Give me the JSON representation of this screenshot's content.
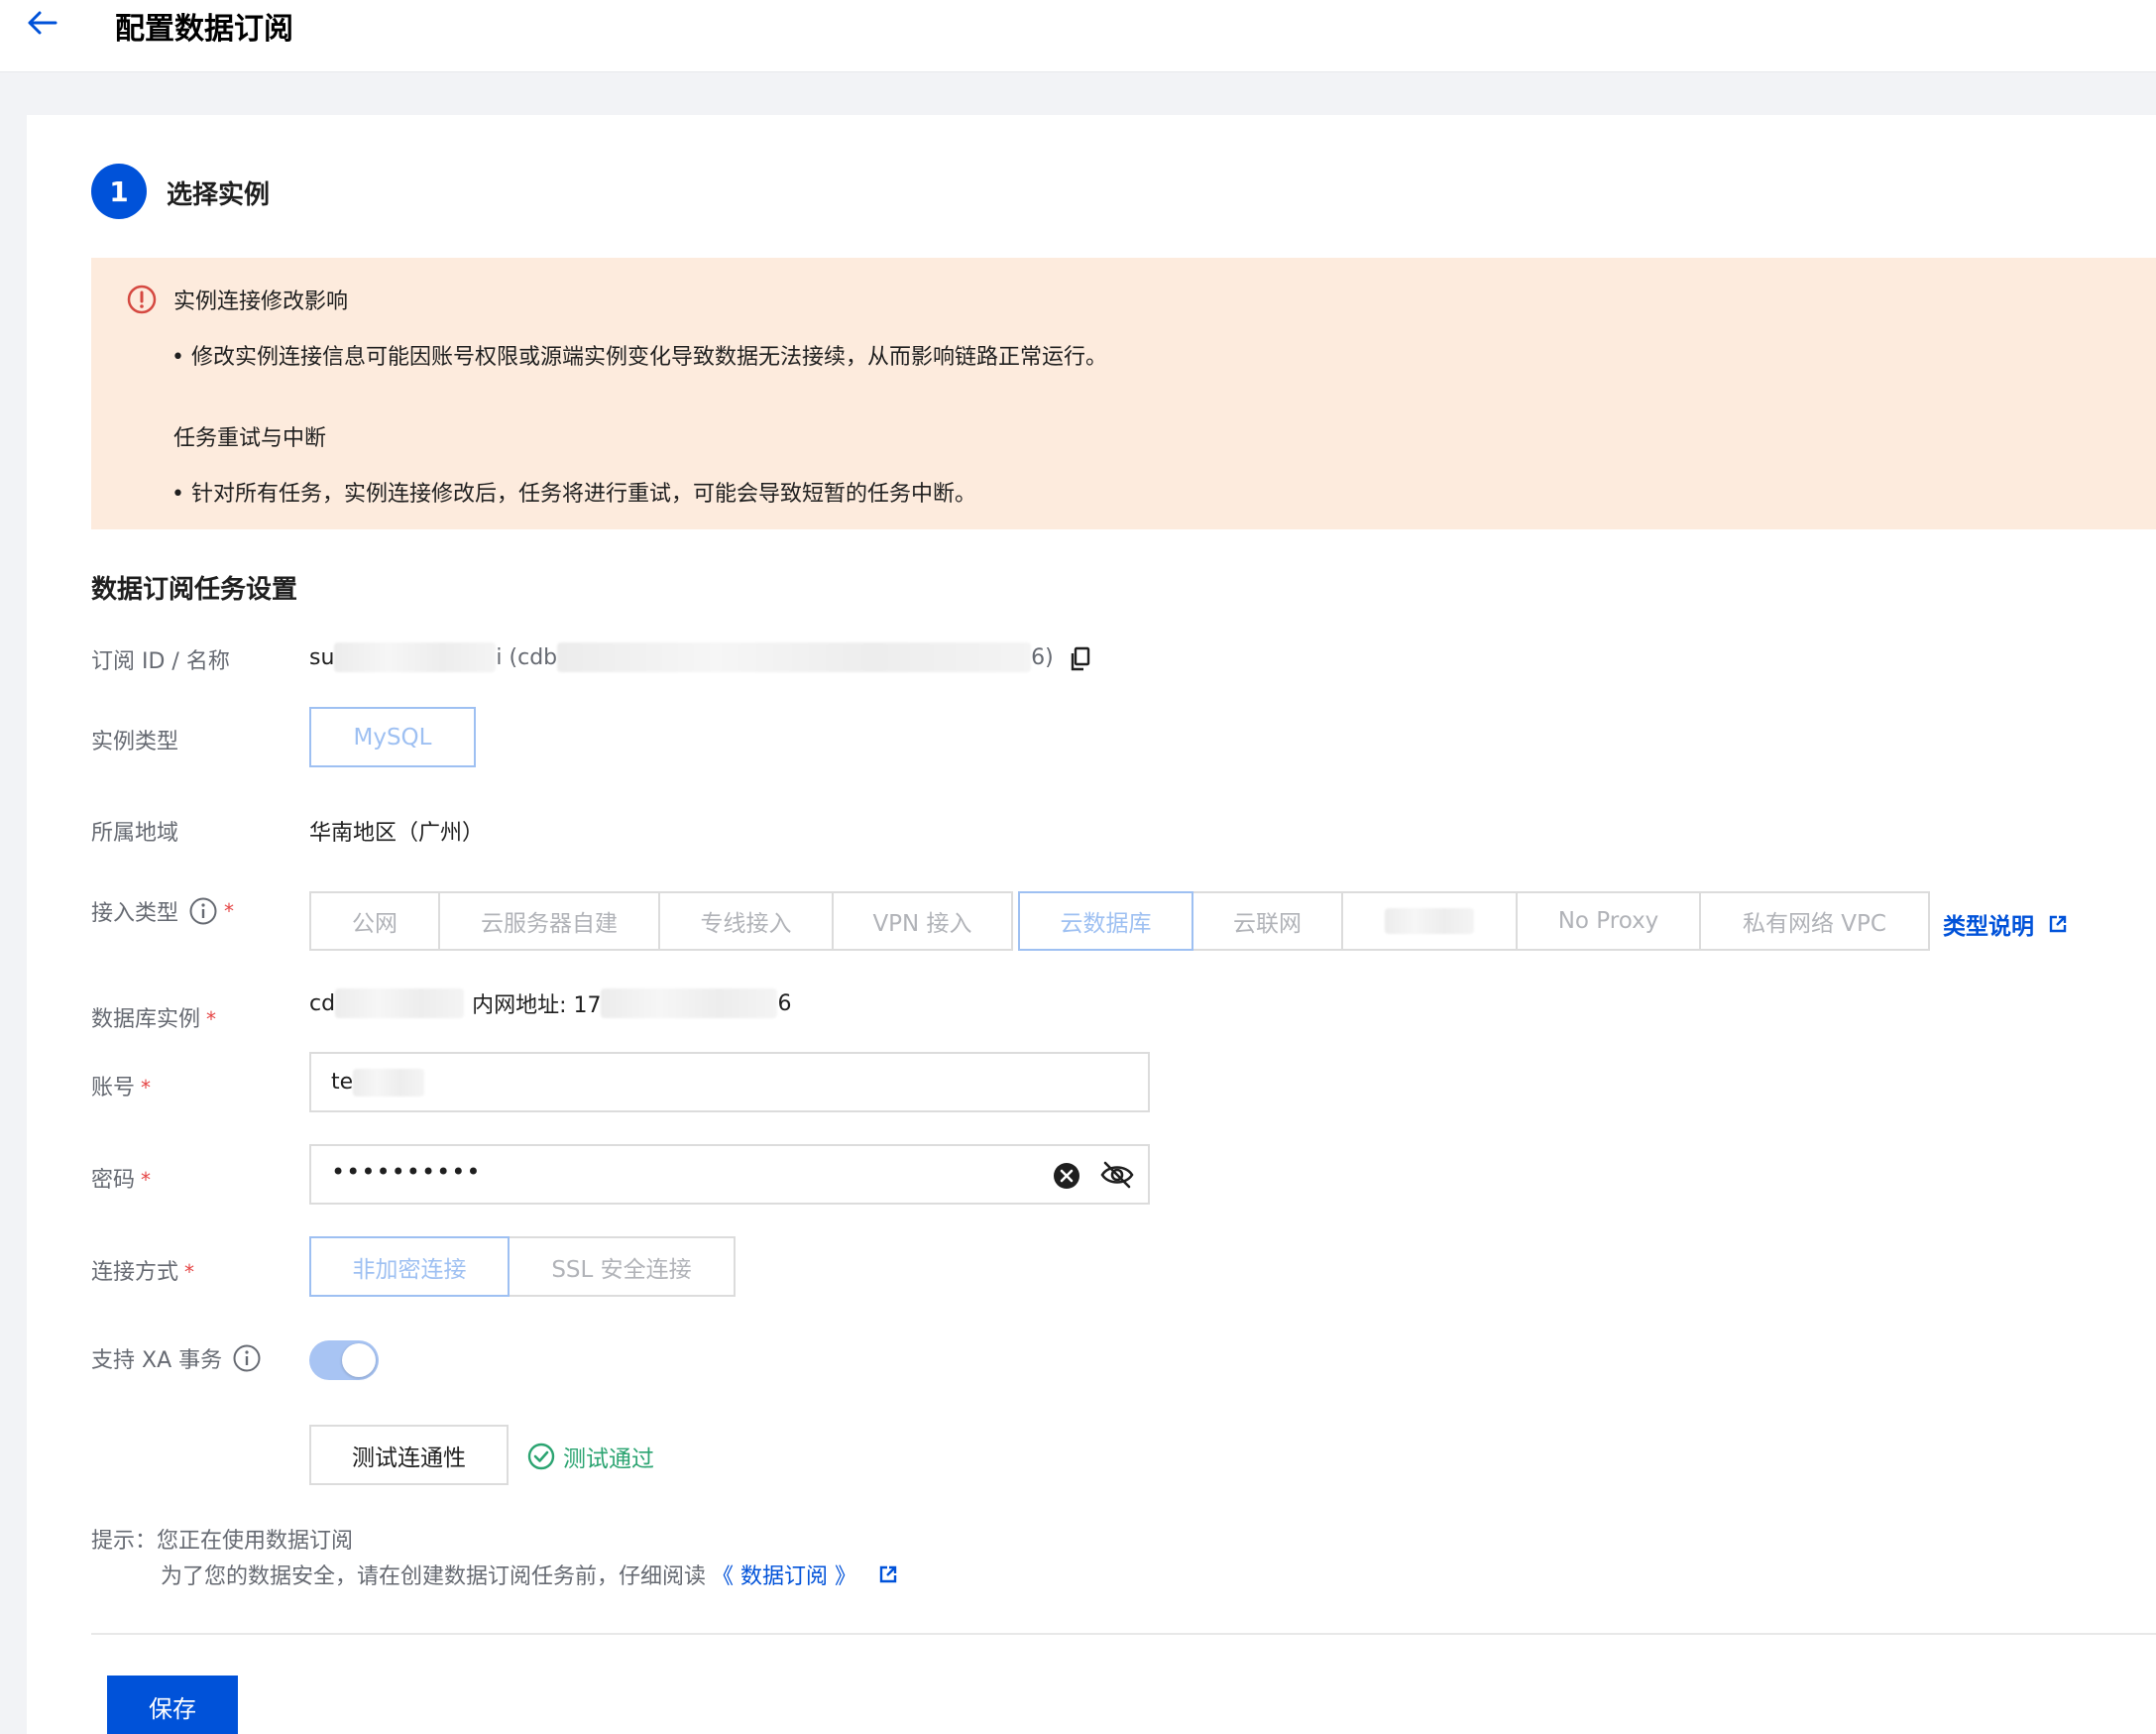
{
  "header": {
    "title": "配置数据订阅"
  },
  "step": {
    "number": "1",
    "title": "选择实例"
  },
  "alert": {
    "title1": "实例连接修改影响",
    "bullet1": "• 修改实例连接信息可能因账号权限或源端实例变化导致数据无法接续，从而影响链路正常运行。",
    "title2": "任务重试与中断",
    "bullet2": "• 针对所有任务，实例连接修改后，任务将进行重试，可能会导致短暂的任务中断。"
  },
  "section": {
    "title": "数据订阅任务设置"
  },
  "form": {
    "sub_id_label": "订阅 ID / 名称",
    "sub_id_prefix": "su",
    "sub_id_mid": "i (cdb",
    "sub_id_suffix": "6)",
    "instance_type_label": "实例类型",
    "instance_type_value": "MySQL",
    "region_label": "所属地域",
    "region_value": "华南地区（广州）",
    "access_type_label": "接入类型",
    "access_types": [
      "公网",
      "云服务器自建",
      "专线接入",
      "VPN 接入",
      "云数据库",
      "云联网",
      "",
      "No Proxy",
      "私有网络 VPC"
    ],
    "access_type_selected": "云数据库",
    "type_help_link": "类型说明",
    "db_instance_label": "数据库实例",
    "db_instance_prefix": "cd",
    "db_inner_addr_label": "内网地址: 17",
    "db_inner_addr_suffix": "6",
    "account_label": "账号",
    "account_value": "te",
    "password_label": "密码",
    "password_value": "••••••••••",
    "conn_mode_label": "连接方式",
    "conn_modes": [
      "非加密连接",
      "SSL 安全连接"
    ],
    "conn_mode_selected": "非加密连接",
    "xa_label": "支持 XA 事务",
    "xa_enabled": true,
    "test_button": "测试连通性",
    "test_result": "测试通过"
  },
  "tips": {
    "line1": "提示：您正在使用数据订阅",
    "line2_text": "为了您的数据安全，请在创建数据订阅任务前，仔细阅读",
    "line2_link": "《 数据订阅 》"
  },
  "footer": {
    "save_button": "保存"
  },
  "colors": {
    "primary": "#0052d9",
    "alert_bg": "#fdebdd",
    "success": "#2ba471",
    "required": "#e54545"
  }
}
